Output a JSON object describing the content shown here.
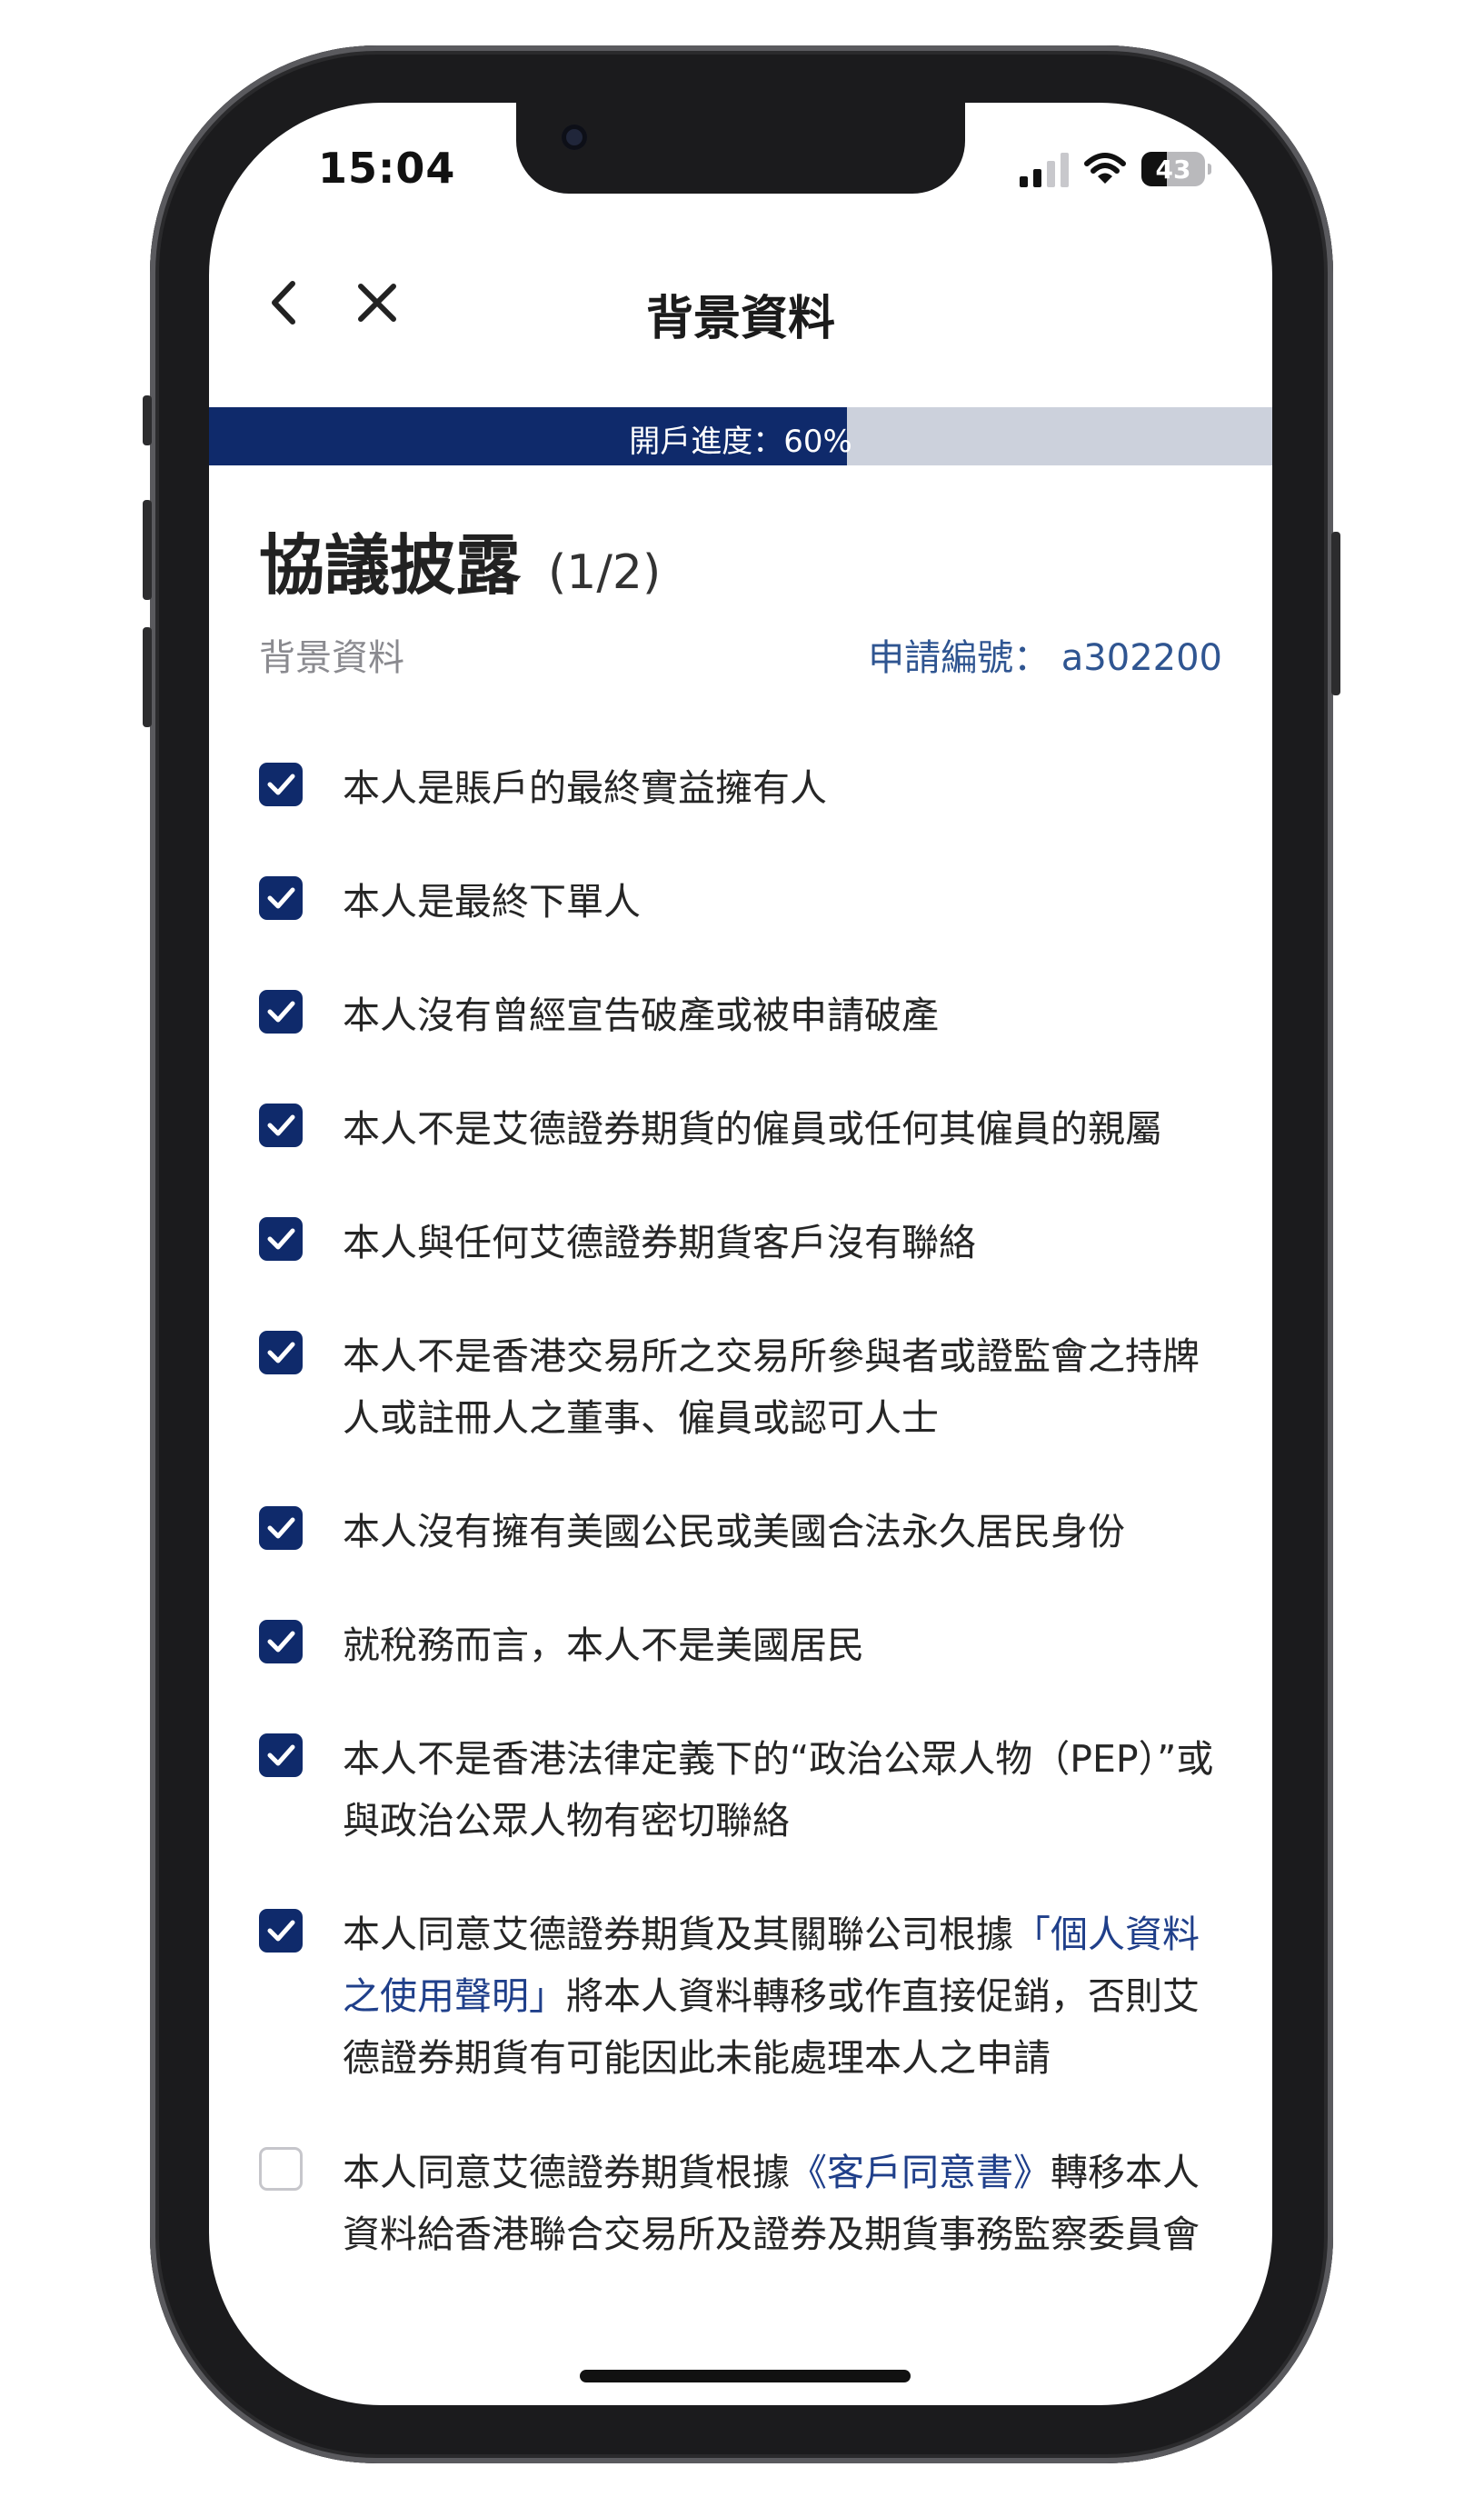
{
  "status_bar": {
    "time": "15:04",
    "battery": "43",
    "icons": [
      "signal-icon",
      "wifi-icon",
      "battery-icon"
    ]
  },
  "navbar": {
    "title": "背景資料",
    "back_icon": "chevron-left-icon",
    "close_icon": "close-icon"
  },
  "progress": {
    "label": "開戶進度：60%",
    "value": 0.6,
    "fill_color": "#0f2a6b",
    "track_color": "#ccd1dc"
  },
  "page": {
    "heading": "協議披露",
    "step": "(1/2)",
    "section": "背景資料",
    "application_no": "申請編號： a302200"
  },
  "items": [
    {
      "checked": true,
      "parts": [
        {
          "text": "本人是賬戶的最終實益擁有人"
        }
      ]
    },
    {
      "checked": true,
      "parts": [
        {
          "text": "本人是最終下單人"
        }
      ]
    },
    {
      "checked": true,
      "parts": [
        {
          "text": "本人沒有曾經宣告破產或被申請破產"
        }
      ]
    },
    {
      "checked": true,
      "parts": [
        {
          "text": "本人不是艾德證券期貨的僱員或任何其僱員的親屬"
        }
      ]
    },
    {
      "checked": true,
      "parts": [
        {
          "text": "本人與任何艾德證券期貨客戶沒有聯絡"
        }
      ]
    },
    {
      "checked": true,
      "parts": [
        {
          "text": "本人不是香港交易所之交易所參與者或證監會之持牌人或註冊人之董事、僱員或認可人士"
        }
      ]
    },
    {
      "checked": true,
      "parts": [
        {
          "text": "本人沒有擁有美國公民或美國合法永久居民身份"
        }
      ]
    },
    {
      "checked": true,
      "parts": [
        {
          "text": "就稅務而言，本人不是美國居民"
        }
      ]
    },
    {
      "checked": true,
      "parts": [
        {
          "text": "本人不是香港法律定義下的“政治公眾人物（PEP）”或與政治公眾人物有密切聯絡"
        }
      ]
    },
    {
      "checked": true,
      "parts": [
        {
          "text": "本人同意艾德證券期貨及其關聯公司根據"
        },
        {
          "text": "「個人資料之使用聲明」",
          "link": true
        },
        {
          "text": "將本人資料轉移或作直接促銷，否則艾德證券期貨有可能因此未能處理本人之申請"
        }
      ]
    },
    {
      "checked": false,
      "parts": [
        {
          "text": "本人同意艾德證券期貨根據"
        },
        {
          "text": "《客戶同意書》",
          "link": true
        },
        {
          "text": "轉移本人資料給香港聯合交易所及證券及期貨事務監察委員會"
        }
      ]
    }
  ],
  "colors": {
    "accent": "#0f2a6b",
    "link": "#1f3f8a",
    "meta": "#2f5591"
  }
}
